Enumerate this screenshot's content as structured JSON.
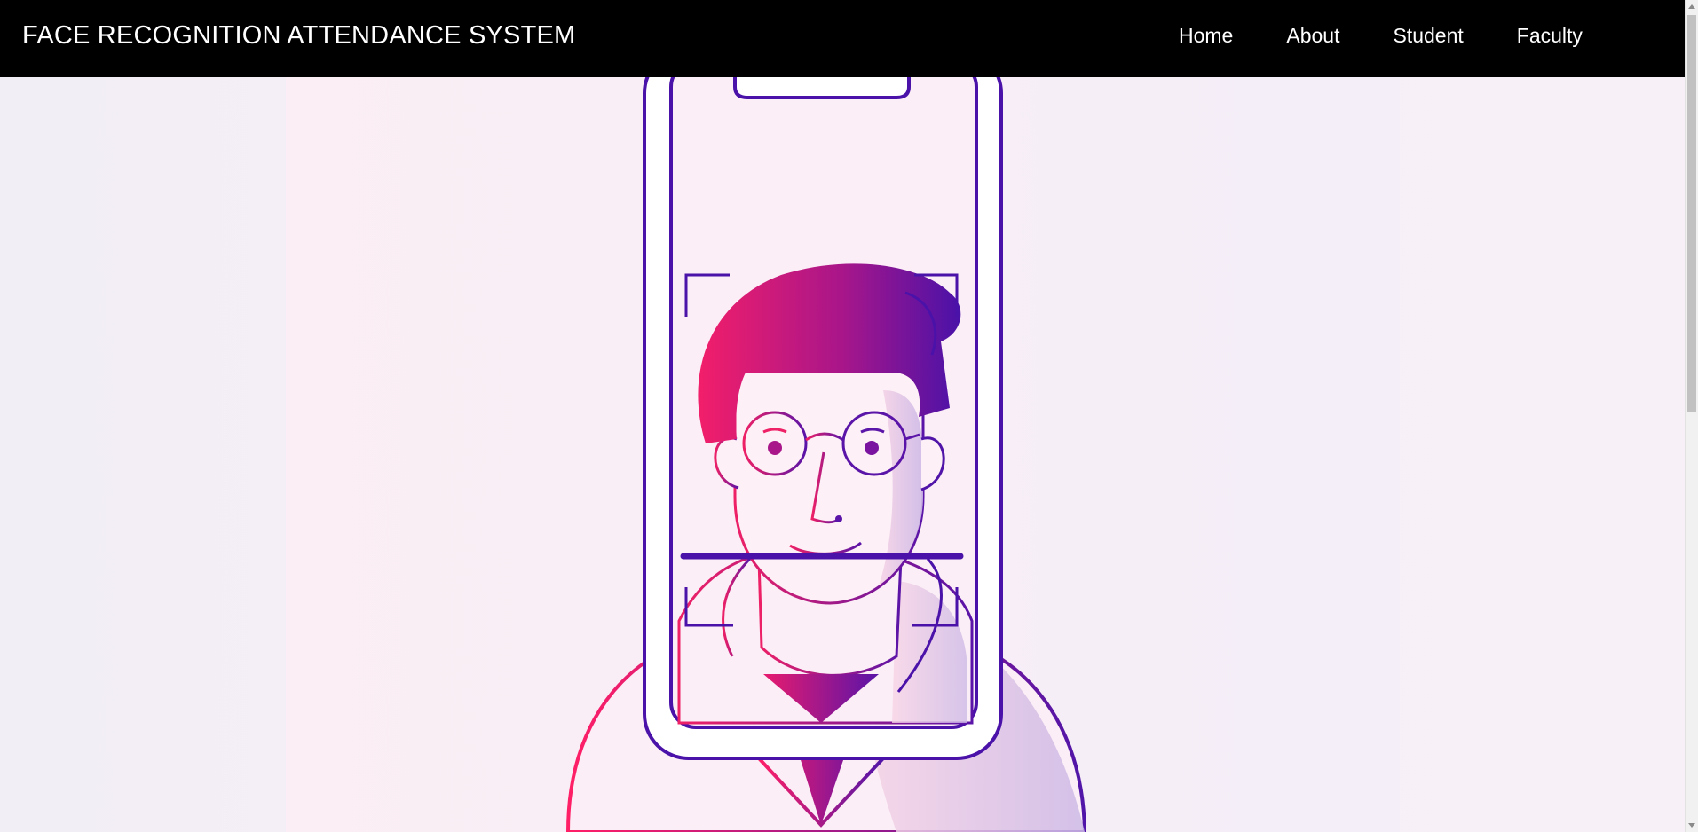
{
  "header": {
    "brand": "FACE RECOGNITION ATTENDANCE SYSTEM",
    "nav": [
      {
        "label": "Home"
      },
      {
        "label": "About"
      },
      {
        "label": "Student"
      },
      {
        "label": "Faculty"
      }
    ]
  },
  "hero": {
    "illustration": "face-scan-phone-illustration"
  },
  "colors": {
    "navbar": "#000000",
    "accent_purple": "#4a0fa8",
    "accent_pink": "#f0206a",
    "background": "#f7f0f7"
  }
}
